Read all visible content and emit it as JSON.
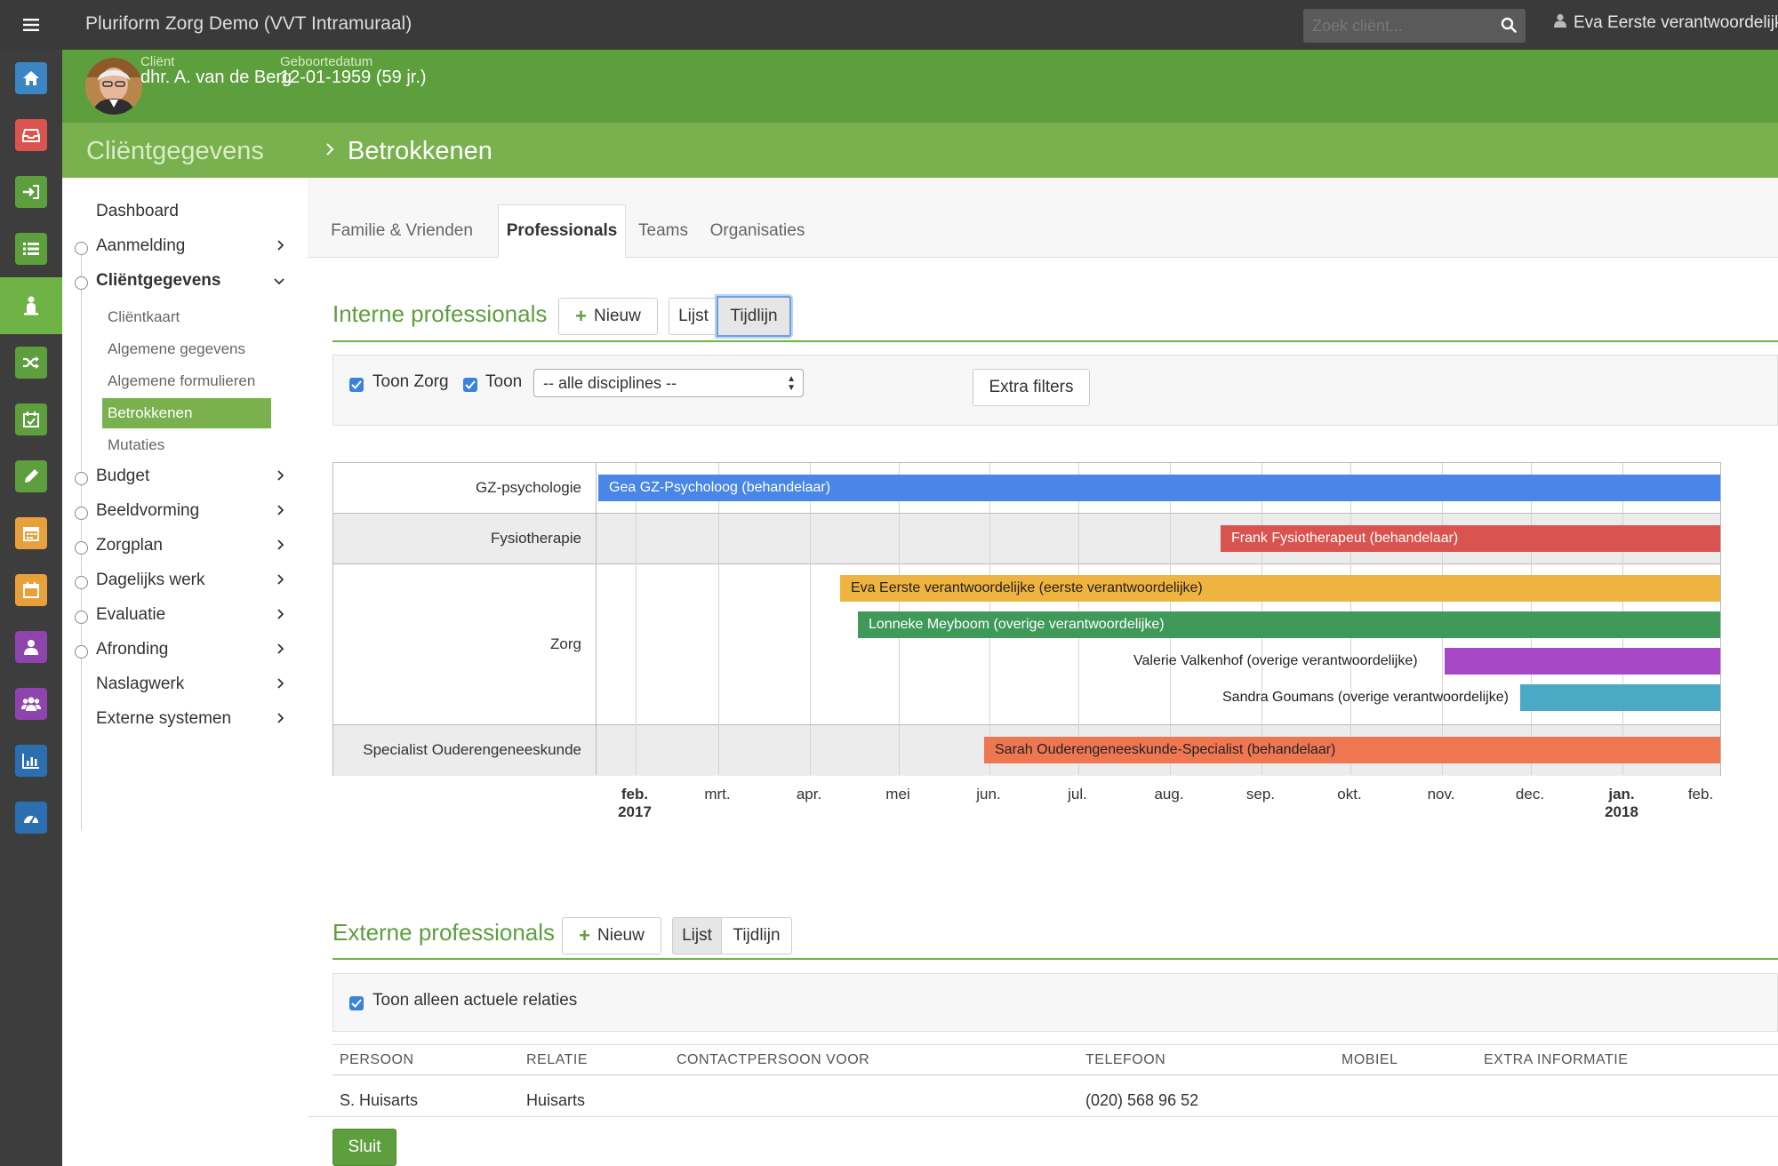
{
  "app": {
    "title": "Pluriform Zorg Demo  (VVT Intramuraal)",
    "search_placeholder": "Zoek cliënt...",
    "user": "Eva Eerste verantwoordelijke"
  },
  "client": {
    "label_client": "Cliënt",
    "name": "dhr. A. van de Berg",
    "label_birth": "Geboortedatum",
    "birthdate": "12-01-1959 (59 jr.)"
  },
  "breadcrumb": {
    "parent": "Cliëntgegevens",
    "current": "Betrokkenen"
  },
  "rail": [
    {
      "icon": "home-icon",
      "color": "#3a86c5"
    },
    {
      "icon": "inbox-icon",
      "color": "#d9534f"
    },
    {
      "icon": "sign-in-icon",
      "color": "#5d9f3d"
    },
    {
      "icon": "list-icon",
      "color": "#5d9f3d"
    },
    {
      "icon": "person-icon",
      "color": "#6fb245"
    },
    {
      "icon": "shuffle-icon",
      "color": "#5d9f3d"
    },
    {
      "icon": "calendar-check-icon",
      "color": "#5d9f3d"
    },
    {
      "icon": "pencil-icon",
      "color": "#5d9f3d"
    },
    {
      "icon": "calendar-icon",
      "color": "#e8a13a"
    },
    {
      "icon": "calendar-blank-icon",
      "color": "#e8a13a"
    },
    {
      "icon": "user-icon",
      "color": "#8e44ad"
    },
    {
      "icon": "users-icon",
      "color": "#8e44ad"
    },
    {
      "icon": "bar-chart-icon",
      "color": "#2c6fb0"
    },
    {
      "icon": "dashboard-icon",
      "color": "#2c6fb0"
    }
  ],
  "sidebar": {
    "items": [
      {
        "label": "Dashboard"
      },
      {
        "label": "Aanmelding"
      },
      {
        "label": "Cliëntgegevens"
      },
      {
        "label": "Budget"
      },
      {
        "label": "Beeldvorming"
      },
      {
        "label": "Zorgplan"
      },
      {
        "label": "Dagelijks werk"
      },
      {
        "label": "Evaluatie"
      },
      {
        "label": "Afronding"
      },
      {
        "label": "Naslagwerk"
      },
      {
        "label": "Externe systemen"
      }
    ],
    "sub_items": [
      {
        "label": "Cliëntkaart"
      },
      {
        "label": "Algemene gegevens"
      },
      {
        "label": "Algemene formulieren"
      },
      {
        "label": "Betrokkenen"
      },
      {
        "label": "Mutaties"
      }
    ]
  },
  "tabs": [
    {
      "label": "Familie & Vrienden"
    },
    {
      "label": "Professionals"
    },
    {
      "label": "Teams"
    },
    {
      "label": "Organisaties"
    }
  ],
  "interne": {
    "title": "Interne professionals",
    "new_label": "Nieuw",
    "view_list": "Lijst",
    "view_timeline": "Tijdlijn",
    "filter_toon_zorg": "Toon Zorg",
    "filter_toon": "Toon",
    "discipline_select": "-- alle disciplines --",
    "extra_filters": "Extra filters"
  },
  "timeline": {
    "rows": [
      {
        "label": "GZ-psychologie"
      },
      {
        "label": "Fysiotherapie"
      },
      {
        "label": "Zorg"
      },
      {
        "label": "Specialist Ouderengeneeskunde"
      }
    ],
    "bars": [
      {
        "label": "Gea GZ-Psycholoog (behandelaar)",
        "color": "#4a86e8"
      },
      {
        "label": "Frank Fysiotherapeut (behandelaar)",
        "color": "#d9534f"
      },
      {
        "label": "Eva Eerste verantwoordelijke (eerste verantwoordelijke)",
        "color": "#efb33f"
      },
      {
        "label": "Lonneke Meyboom (overige verantwoordelijke)",
        "color": "#3f9a5a"
      },
      {
        "label": "Valerie Valkenhof (overige verantwoordelijke)",
        "color": "#a648c6"
      },
      {
        "label": "Sandra Goumans (overige verantwoordelijke)",
        "color": "#4aaac5"
      },
      {
        "label": "Sarah Ouderengeneeskunde-Specialist (behandelaar)",
        "color": "#ee7752"
      }
    ],
    "ticks": [
      {
        "m": "feb.",
        "y": "2017"
      },
      {
        "m": "mrt.",
        "y": ""
      },
      {
        "m": "apr.",
        "y": ""
      },
      {
        "m": "mei",
        "y": ""
      },
      {
        "m": "jun.",
        "y": ""
      },
      {
        "m": "jul.",
        "y": ""
      },
      {
        "m": "aug.",
        "y": ""
      },
      {
        "m": "sep.",
        "y": ""
      },
      {
        "m": "okt.",
        "y": ""
      },
      {
        "m": "nov.",
        "y": ""
      },
      {
        "m": "dec.",
        "y": ""
      },
      {
        "m": "jan.",
        "y": "2018"
      },
      {
        "m": "feb.",
        "y": ""
      }
    ]
  },
  "externe": {
    "title": "Externe professionals",
    "new_label": "Nieuw",
    "view_list": "Lijst",
    "view_timeline": "Tijdlijn",
    "filter_actueel": "Toon alleen actuele relaties",
    "columns": [
      "PERSOON",
      "RELATIE",
      "CONTACTPERSOON VOOR",
      "TELEFOON",
      "MOBIEL",
      "EXTRA INFORMATIE"
    ],
    "rows": [
      {
        "persoon": "S. Huisarts",
        "relatie": "Huisarts",
        "contactpersoon": "",
        "telefoon": "(020) 568 96 52",
        "mobiel": "",
        "extra": ""
      }
    ]
  },
  "footer": {
    "close_label": "Sluit"
  }
}
